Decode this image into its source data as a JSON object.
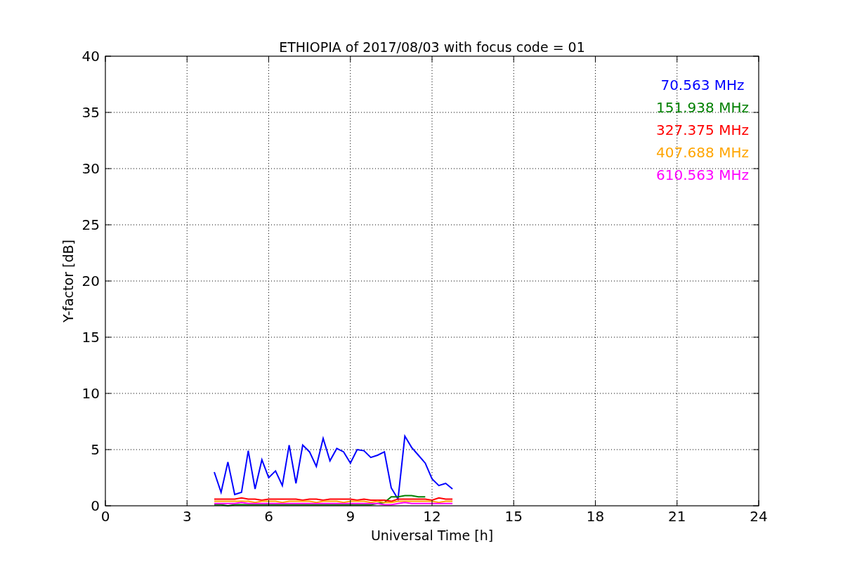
{
  "chart_data": {
    "type": "line",
    "title": "ETHIOPIA of 2017/08/03 with focus code = 01",
    "xlabel": "Universal Time [h]",
    "ylabel": "Y-factor [dB]",
    "x": [
      4,
      4.25,
      4.5,
      4.75,
      5,
      5.25,
      5.5,
      5.75,
      6,
      6.25,
      6.5,
      6.75,
      7,
      7.25,
      7.5,
      7.75,
      8,
      8.25,
      8.5,
      8.75,
      9,
      9.25,
      9.5,
      9.75,
      10,
      10.25,
      10.5,
      10.75,
      11,
      11.25,
      11.5,
      11.75,
      12,
      12.25,
      12.5,
      12.75
    ],
    "series": [
      {
        "name": "70.563 MHz",
        "color": "#0000ff",
        "values": [
          3.0,
          1.2,
          3.9,
          1.0,
          1.2,
          4.9,
          1.5,
          4.1,
          2.5,
          3.1,
          1.8,
          5.4,
          2.0,
          5.4,
          4.8,
          3.5,
          6.0,
          4.0,
          5.1,
          4.8,
          3.8,
          5.0,
          4.9,
          4.3,
          4.5,
          4.8,
          1.6,
          0.6,
          6.2,
          5.2,
          4.5,
          3.8,
          2.4,
          1.8,
          2.0,
          1.5
        ]
      },
      {
        "name": "151.938 MHz",
        "color": "#008000",
        "values": [
          0.1,
          0.1,
          0.0,
          0.1,
          0.1,
          0.1,
          0.1,
          0.1,
          0.1,
          0.1,
          0.1,
          0.1,
          0.1,
          0.1,
          0.1,
          0.1,
          0.1,
          0.1,
          0.1,
          0.1,
          0.1,
          0.1,
          0.1,
          0.1,
          0.2,
          0.3,
          0.8,
          0.8,
          0.9,
          0.9,
          0.8,
          0.8,
          null,
          null,
          null,
          null
        ]
      },
      {
        "name": "327.375 MHz",
        "color": "#ff0000",
        "values": [
          0.6,
          0.6,
          0.6,
          0.6,
          0.7,
          0.6,
          0.6,
          0.5,
          0.6,
          0.6,
          0.6,
          0.6,
          0.6,
          0.5,
          0.6,
          0.6,
          0.5,
          0.6,
          0.6,
          0.6,
          0.6,
          0.5,
          0.6,
          0.5,
          0.5,
          0.5,
          0.4,
          0.6,
          0.6,
          0.6,
          0.6,
          0.6,
          0.5,
          0.7,
          0.6,
          0.6
        ]
      },
      {
        "name": "407.688 MHz",
        "color": "#ffa500",
        "values": [
          0.4,
          0.4,
          0.4,
          0.4,
          0.4,
          0.4,
          0.3,
          0.4,
          0.4,
          0.4,
          0.3,
          0.4,
          0.4,
          0.4,
          0.4,
          0.3,
          0.4,
          0.4,
          0.4,
          0.3,
          0.4,
          0.4,
          0.4,
          0.3,
          0.4,
          0.3,
          0.3,
          0.4,
          0.4,
          0.4,
          0.4,
          0.4,
          0.4,
          0.3,
          0.4,
          0.4
        ]
      },
      {
        "name": "610.563 MHz",
        "color": "#ff00ff",
        "values": [
          0.2,
          0.2,
          0.2,
          0.2,
          0.3,
          0.2,
          0.2,
          0.2,
          0.2,
          0.2,
          0.2,
          0.2,
          0.2,
          0.2,
          0.2,
          0.2,
          0.2,
          0.2,
          0.2,
          0.2,
          0.2,
          0.2,
          0.2,
          0.2,
          0.2,
          0.1,
          0.1,
          0.2,
          0.3,
          0.2,
          0.2,
          0.2,
          0.2,
          0.2,
          0.2,
          0.2
        ]
      }
    ],
    "grid": true,
    "xlim": [
      0,
      24
    ],
    "ylim": [
      0,
      40
    ],
    "xticks": [
      0,
      3,
      6,
      9,
      12,
      15,
      18,
      21,
      24
    ],
    "yticks": [
      0,
      5,
      10,
      15,
      20,
      25,
      30,
      35,
      40
    ]
  }
}
